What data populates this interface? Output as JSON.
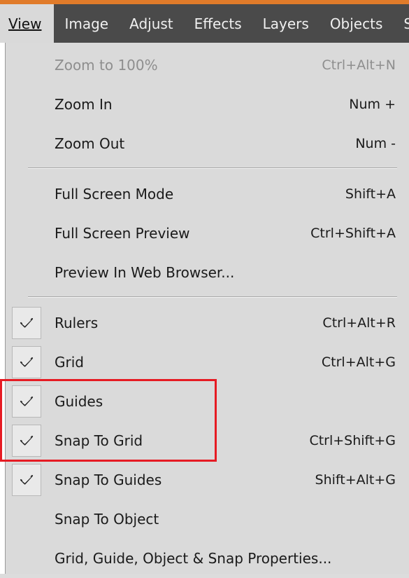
{
  "menubar": {
    "items": [
      "View",
      "Image",
      "Adjust",
      "Effects",
      "Layers",
      "Objects",
      "S"
    ],
    "active": "View"
  },
  "menu": {
    "zoom_to_100": {
      "label": "Zoom to 100%",
      "shortcut": "Ctrl+Alt+N",
      "enabled": false
    },
    "zoom_in": {
      "label": "Zoom In",
      "shortcut": "Num +"
    },
    "zoom_out": {
      "label": "Zoom Out",
      "shortcut": "Num -"
    },
    "full_screen_mode": {
      "label": "Full Screen Mode",
      "shortcut": "Shift+A"
    },
    "full_screen_preview": {
      "label": "Full Screen Preview",
      "shortcut": "Ctrl+Shift+A"
    },
    "preview_web": {
      "label": "Preview In Web Browser..."
    },
    "rulers": {
      "label": "Rulers",
      "shortcut": "Ctrl+Alt+R",
      "checked": true
    },
    "grid": {
      "label": "Grid",
      "shortcut": "Ctrl+Alt+G",
      "checked": true
    },
    "guides": {
      "label": "Guides",
      "checked": true
    },
    "snap_grid": {
      "label": "Snap To Grid",
      "shortcut": "Ctrl+Shift+G",
      "checked": true
    },
    "snap_guides": {
      "label": "Snap To Guides",
      "shortcut": "Shift+Alt+G",
      "checked": true
    },
    "snap_object": {
      "label": "Snap To Object"
    },
    "snap_properties": {
      "label": "Grid, Guide, Object & Snap Properties..."
    }
  },
  "colors": {
    "menubar_bg": "#4a4a4a",
    "top_accent": "#e07b2a",
    "menu_bg": "#dadada",
    "highlight_annotation": "#e61b23"
  },
  "icons": {
    "check": "checkmark-icon"
  }
}
